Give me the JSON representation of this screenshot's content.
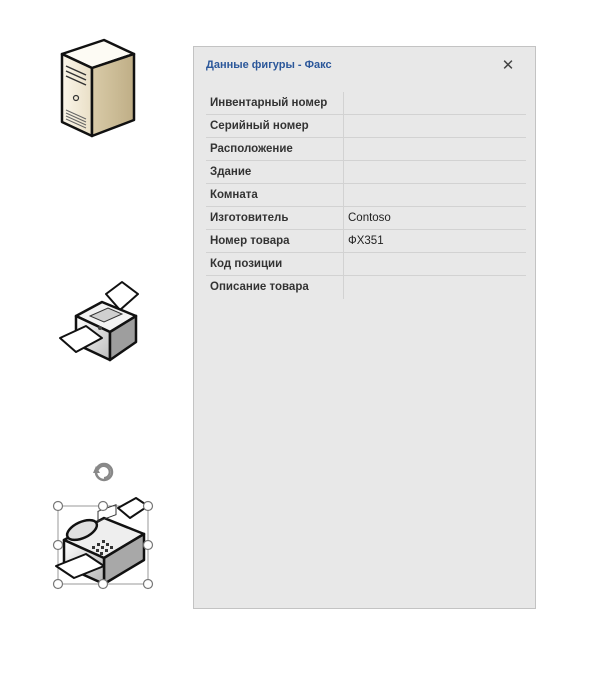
{
  "panel": {
    "title": "Данные фигуры - Факс",
    "close_icon": "close-icon"
  },
  "rows": [
    {
      "label": "Инвентарный номер",
      "value": ""
    },
    {
      "label": "Серийный номер",
      "value": ""
    },
    {
      "label": "Расположение",
      "value": ""
    },
    {
      "label": "Здание",
      "value": ""
    },
    {
      "label": "Комната",
      "value": ""
    },
    {
      "label": "Изготовитель",
      "value": "Contoso"
    },
    {
      "label": "Номер товара",
      "value": "ФХ351"
    },
    {
      "label": "Код позиции",
      "value": ""
    },
    {
      "label": "Описание товара",
      "value": ""
    }
  ],
  "shapes": {
    "server_icon": "server-icon",
    "printer_icon": "printer-icon",
    "fax_icon": "fax-icon"
  },
  "colors": {
    "title": "#2b579a",
    "panel_bg": "#e8e8e8"
  }
}
